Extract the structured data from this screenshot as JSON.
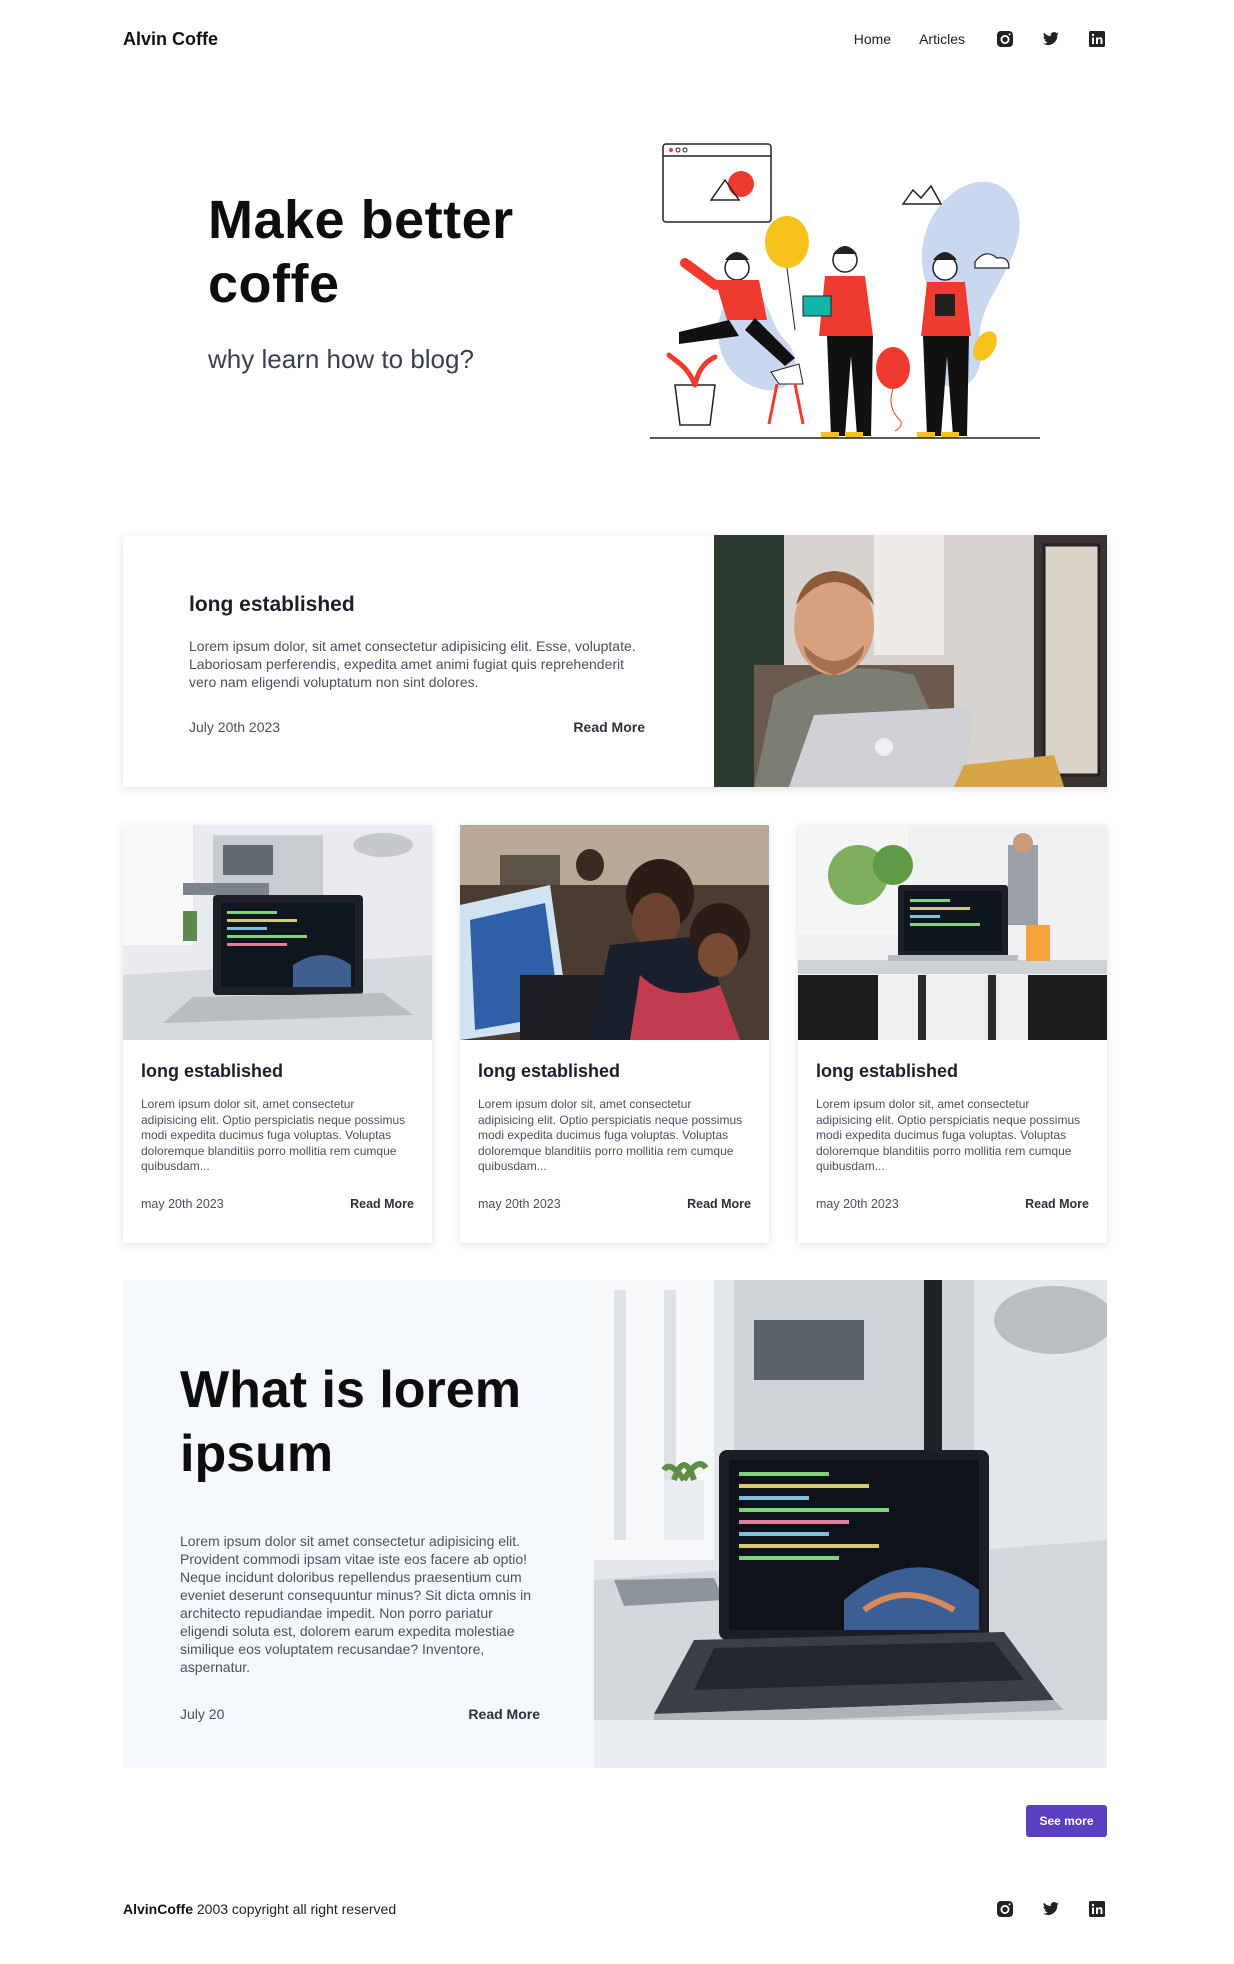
{
  "header": {
    "brand": "Alvin Coffe",
    "nav": [
      {
        "label": "Home"
      },
      {
        "label": "Articles"
      }
    ],
    "social_icons": [
      "instagram-icon",
      "twitter-icon",
      "linkedin-icon"
    ]
  },
  "hero": {
    "title": "Make better coffe",
    "subtitle": "why learn how to blog?",
    "illustration": "team-celebration-illustration"
  },
  "featured": {
    "title": "long established",
    "body": "Lorem ipsum dolor, sit amet consectetur adipisicing elit. Esse, voluptate. Laboriosam perferendis, expedita amet animi fugiat quis reprehenderit vero nam eligendi voluptatum non sint dolores.",
    "date": "July 20th 2023",
    "read_more": "Read More",
    "image": "man-with-laptop-photo"
  },
  "cards": [
    {
      "title": "long established",
      "body": "Lorem ipsum dolor sit, amet consectetur adipisicing elit. Optio perspiciatis neque possimus modi expedita ducimus fuga voluptas. Voluptas doloremque blanditiis porro mollitia rem cumque quibusdam...",
      "date": "may 20th 2023",
      "read_more": "Read More",
      "image": "laptop-desk-photo"
    },
    {
      "title": "long established",
      "body": "Lorem ipsum dolor sit, amet consectetur adipisicing elit. Optio perspiciatis neque possimus modi expedita ducimus fuga voluptas. Voluptas doloremque blanditiis porro mollitia rem cumque quibusdam...",
      "date": "may 20th 2023",
      "read_more": "Read More",
      "image": "people-coding-photo"
    },
    {
      "title": "long established",
      "body": "Lorem ipsum dolor sit, amet consectetur adipisicing elit. Optio perspiciatis neque possimus modi expedita ducimus fuga voluptas. Voluptas doloremque blanditiis porro mollitia rem cumque quibusdam...",
      "date": "may 20th 2023",
      "read_more": "Read More",
      "image": "cafe-laptop-photo"
    }
  ],
  "big_article": {
    "title": "What is lorem ipsum",
    "body": "Lorem ipsum dolor sit amet consectetur adipisicing elit. Provident commodi ipsam vitae iste eos facere ab optio! Neque incidunt doloribus repellendus praesentium cum eveniet deserunt consequuntur minus? Sit dicta omnis in architecto repudiandae impedit. Non porro pariatur eligendi soluta est, dolorem earum expedita molestiae similique eos voluptatem recusandae? Inventore, aspernatur.",
    "date": "July 20",
    "read_more": "Read More",
    "image": "laptop-code-photo"
  },
  "see_more": "See more",
  "footer": {
    "brand": "AlvinCoffe",
    "copyright": " 2003 copyright all right reserved"
  },
  "colors": {
    "accent": "#5a3fc0",
    "text": "#1b1f2a",
    "muted": "#4a5060",
    "section_bg": "#f5f8fc"
  }
}
